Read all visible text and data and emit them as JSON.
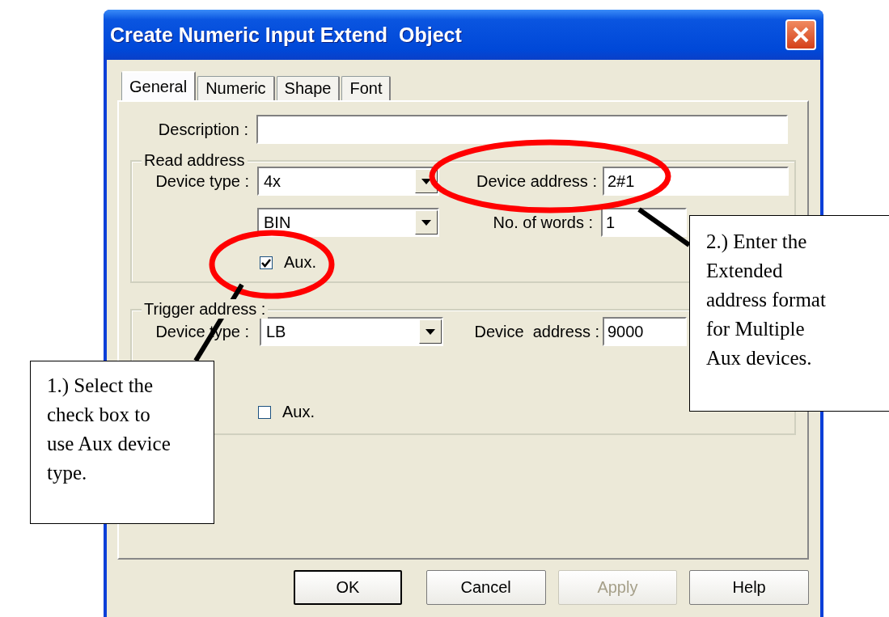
{
  "window": {
    "title": "Create Numeric Input Extend  Object"
  },
  "tabs": [
    {
      "label": "General",
      "selected": true
    },
    {
      "label": "Numeric",
      "selected": false
    },
    {
      "label": "Shape",
      "selected": false
    },
    {
      "label": "Font",
      "selected": false
    }
  ],
  "description": {
    "label": "Description :"
  },
  "read_address": {
    "title": "Read address",
    "device_type": {
      "label": "Device type :",
      "value": "4x"
    },
    "format": {
      "value": "BIN"
    },
    "device_address": {
      "label": "Device address :",
      "value": "2#1"
    },
    "no_of_words": {
      "label": "No. of words :",
      "value": "1"
    },
    "aux": {
      "label": "Aux.",
      "checked": true
    }
  },
  "trigger_address": {
    "title": "Trigger address :",
    "device_type": {
      "label": "Device type :",
      "value": "LB"
    },
    "device_address": {
      "label": "Device  address :",
      "value": "9000"
    },
    "aux": {
      "label": "Aux.",
      "checked": false
    }
  },
  "buttons": [
    {
      "label": "OK",
      "disabled": false,
      "default": true
    },
    {
      "label": "Cancel",
      "disabled": false,
      "default": false
    },
    {
      "label": "Apply",
      "disabled": true,
      "default": false
    },
    {
      "label": "Help",
      "disabled": false,
      "default": false
    }
  ],
  "callouts": [
    {
      "lines": [
        "1.) Select the",
        "check box to",
        "use Aux device",
        "type."
      ]
    },
    {
      "lines": [
        "2.) Enter the",
        "Extended",
        "address format",
        "for Multiple",
        "Aux devices."
      ]
    }
  ]
}
